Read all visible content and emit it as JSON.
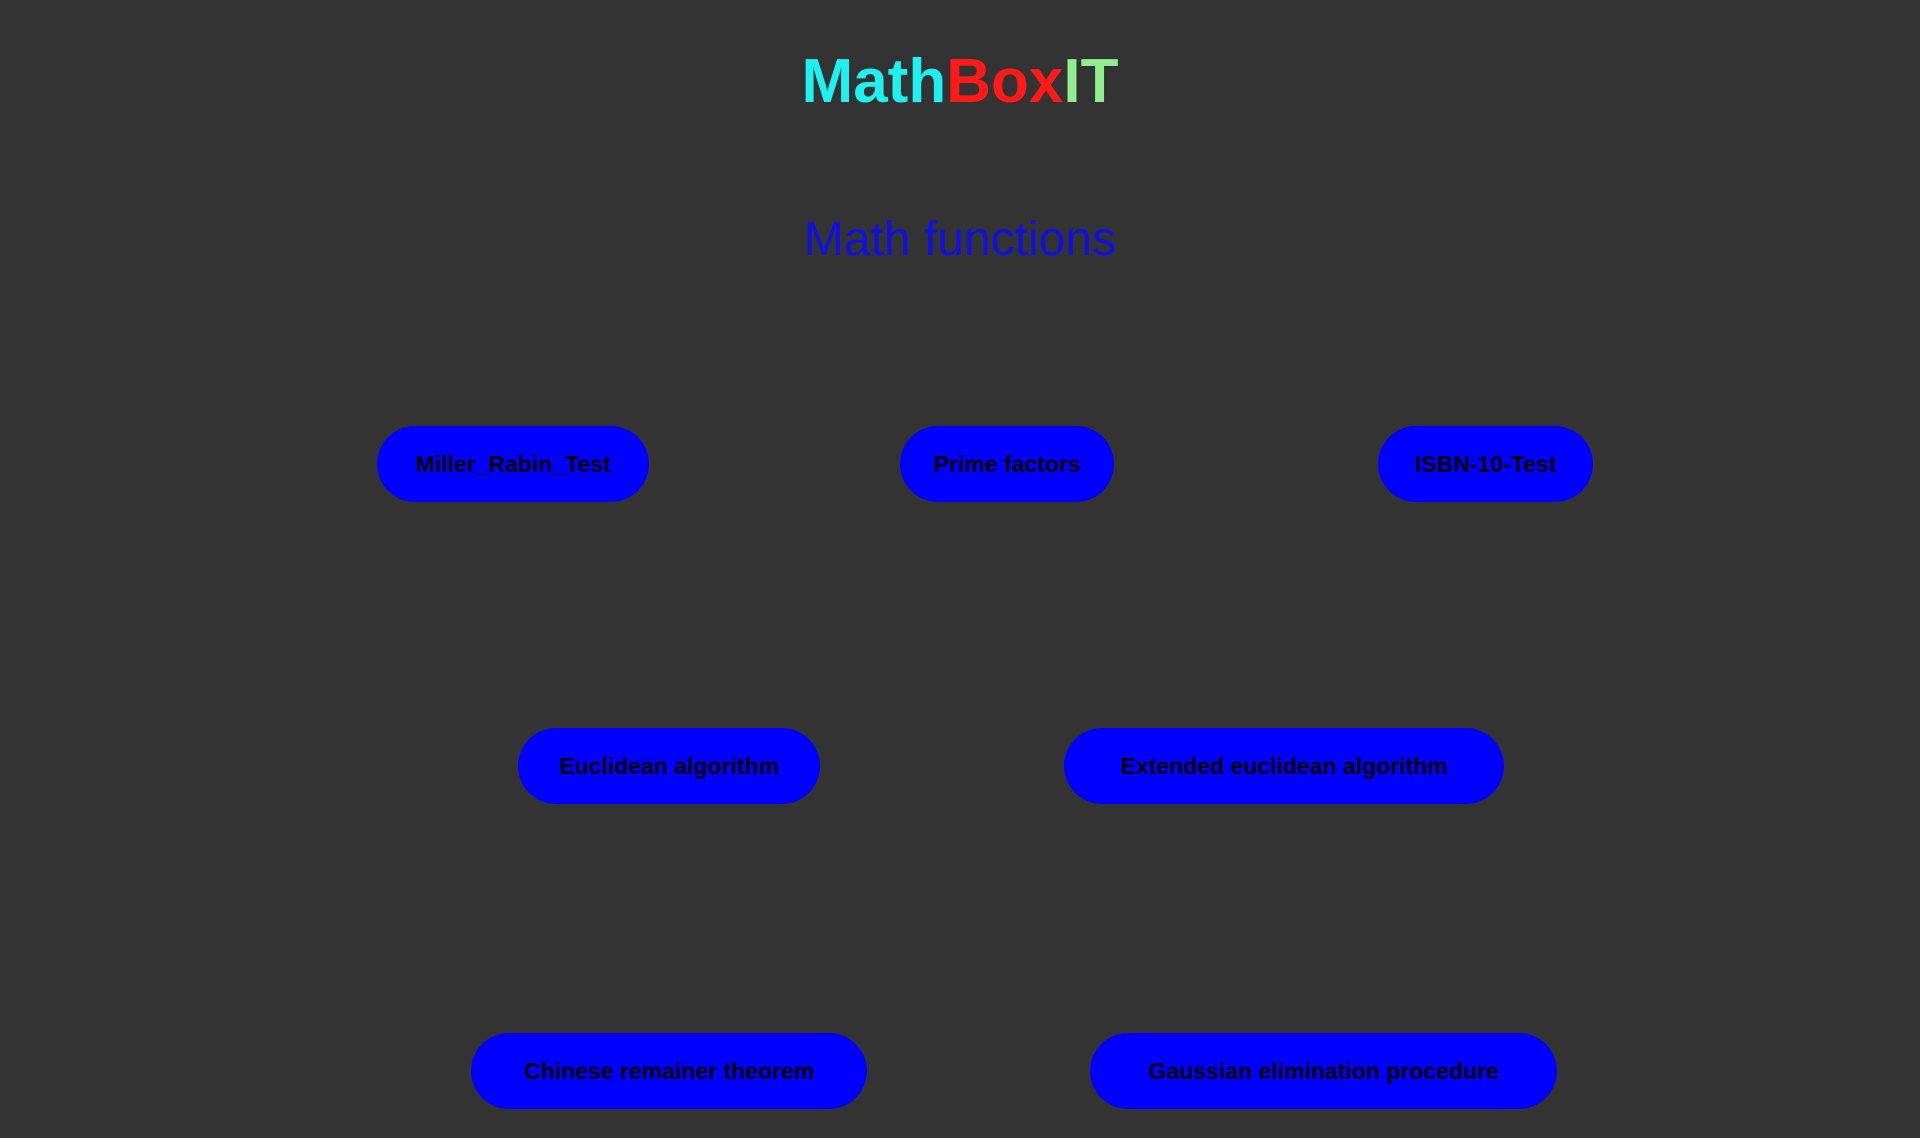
{
  "logo": {
    "part1": "Math",
    "part2": "Box",
    "part3": "IT",
    "colors": {
      "part1": "#1ff0f0",
      "part2": "#ff1a1a",
      "part3": "#90ee90"
    }
  },
  "heading": {
    "text": "Math functions",
    "color": "#1010e0"
  },
  "buttons": {
    "color": "#0000ff",
    "items": [
      {
        "label": "Miller_Rabin_Test"
      },
      {
        "label": "Prime factors"
      },
      {
        "label": "ISBN-10-Test"
      },
      {
        "label": "Euclidean algorithm"
      },
      {
        "label": "Extended euclidean algorithm"
      },
      {
        "label": "Chinese remainer theorem"
      },
      {
        "label": "Gaussian elimination procedure"
      }
    ]
  }
}
